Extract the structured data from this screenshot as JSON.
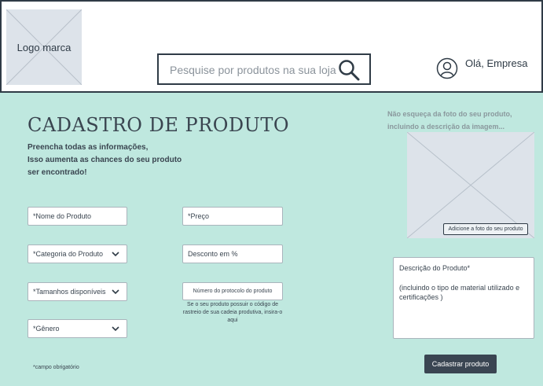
{
  "header": {
    "logo_text": "Logo marca",
    "search_placeholder": "Pesquise por produtos na sua loja",
    "greeting": "Olá, Empresa"
  },
  "page": {
    "title": "CADASTRO DE PRODUTO",
    "subtitle_lines": [
      "Preencha todas as informações,",
      "Isso aumenta as chances do seu produto ser encontrado!"
    ]
  },
  "form": {
    "product_name": "*Nome do Produto",
    "price": "*Preço",
    "category": "*Categoria do Produto",
    "discount": "Desconto em %",
    "sizes": "*Tamanhos disponíveis",
    "protocol": "Número do protocolo do produto",
    "protocol_note": "Se o seu produto possuir o código de rastreio de sua cadeia produtiva, insira-o aqui",
    "gender": "*Gênero",
    "required_note": "*campo obrigatório"
  },
  "photo": {
    "tip": "Não esqueça da foto do seu produto,  incluindo a descrição da imagem...",
    "add_button": "Adicione a foto do seu produto"
  },
  "description": {
    "title": "Descrição do Produto*",
    "hint": "(incluindo o tipo de material utilizado e certificações )"
  },
  "submit_label": "Cadastrar produto",
  "colors": {
    "background": "#bfe8df",
    "dark": "#2f3b46",
    "button": "#3a4552",
    "placeholder_fill": "#dde3ea"
  }
}
